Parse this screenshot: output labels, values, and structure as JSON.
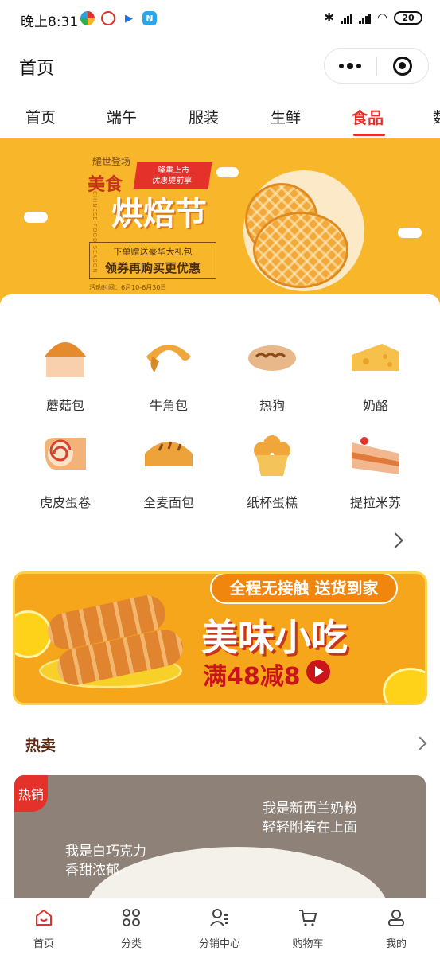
{
  "status_bar": {
    "time": "晚上8:31",
    "battery": "20",
    "network_labels": [
      "HD",
      "HD"
    ],
    "apps": [
      {
        "icon": "colorful-app-icon",
        "color": "#2aa1e0"
      },
      {
        "icon": "weibo-like-app-icon",
        "color": "#e4322b"
      },
      {
        "icon": "video-app-icon",
        "color": "#1a73e8",
        "label": "Tencent"
      },
      {
        "icon": "n-app-icon",
        "color": "#29a6f0",
        "label": "N"
      }
    ]
  },
  "nav_bar": {
    "title": "首页",
    "menu_icon": "more-dots-icon",
    "close_icon": "target-icon"
  },
  "tabs": {
    "items": [
      {
        "label": "首页",
        "active": false
      },
      {
        "label": "端午",
        "active": false
      },
      {
        "label": "服装",
        "active": false
      },
      {
        "label": "生鲜",
        "active": false
      },
      {
        "label": "食品",
        "active": true
      },
      {
        "label": "数",
        "active": false
      }
    ],
    "accent": "#e4322b"
  },
  "banner": {
    "subtitle": "耀世登场",
    "food": "美食",
    "tag_line1": "隆重上市",
    "tag_line2": "优惠提前享",
    "english": "CHINESE FOOD SEASON",
    "big_title": "烘焙节",
    "gift_line": "下单赠送豪华大礼包",
    "coupon_line": "领券再购买更优惠",
    "date": "活动时间：6月10-6月30日",
    "bg_color": "#f8b62b"
  },
  "categories": [
    {
      "label": "蘑菇包",
      "icon": "mushroom-bun-icon"
    },
    {
      "label": "牛角包",
      "icon": "croissant-icon"
    },
    {
      "label": "热狗",
      "icon": "hotdog-bread-icon"
    },
    {
      "label": "奶酪",
      "icon": "cheese-icon"
    },
    {
      "label": "虎皮蛋卷",
      "icon": "swiss-roll-icon"
    },
    {
      "label": "全麦面包",
      "icon": "wholewheat-bread-icon"
    },
    {
      "label": "纸杯蛋糕",
      "icon": "cupcake-icon"
    },
    {
      "label": "提拉米苏",
      "icon": "tiramisu-cake-icon"
    }
  ],
  "promo": {
    "pill": "全程无接触 送货到家",
    "title": "美味小吃",
    "offer": "满48减8",
    "play_icon": "play-icon"
  },
  "hot": {
    "title": "热卖",
    "badge": "热销",
    "text_left_1": "我是白巧克力",
    "text_left_2": "香甜浓郁",
    "text_right_1": "我是新西兰奶粉",
    "text_right_2": "轻轻附着在上面"
  },
  "tabbar": {
    "items": [
      {
        "label": "首页",
        "icon": "home-icon",
        "active": true
      },
      {
        "label": "分类",
        "icon": "category-grid-icon",
        "active": false
      },
      {
        "label": "分销中心",
        "icon": "distribution-user-icon",
        "active": false
      },
      {
        "label": "购物车",
        "icon": "cart-icon",
        "active": false
      },
      {
        "label": "我的",
        "icon": "profile-icon",
        "active": false
      }
    ],
    "active_color": "#e4322b"
  }
}
